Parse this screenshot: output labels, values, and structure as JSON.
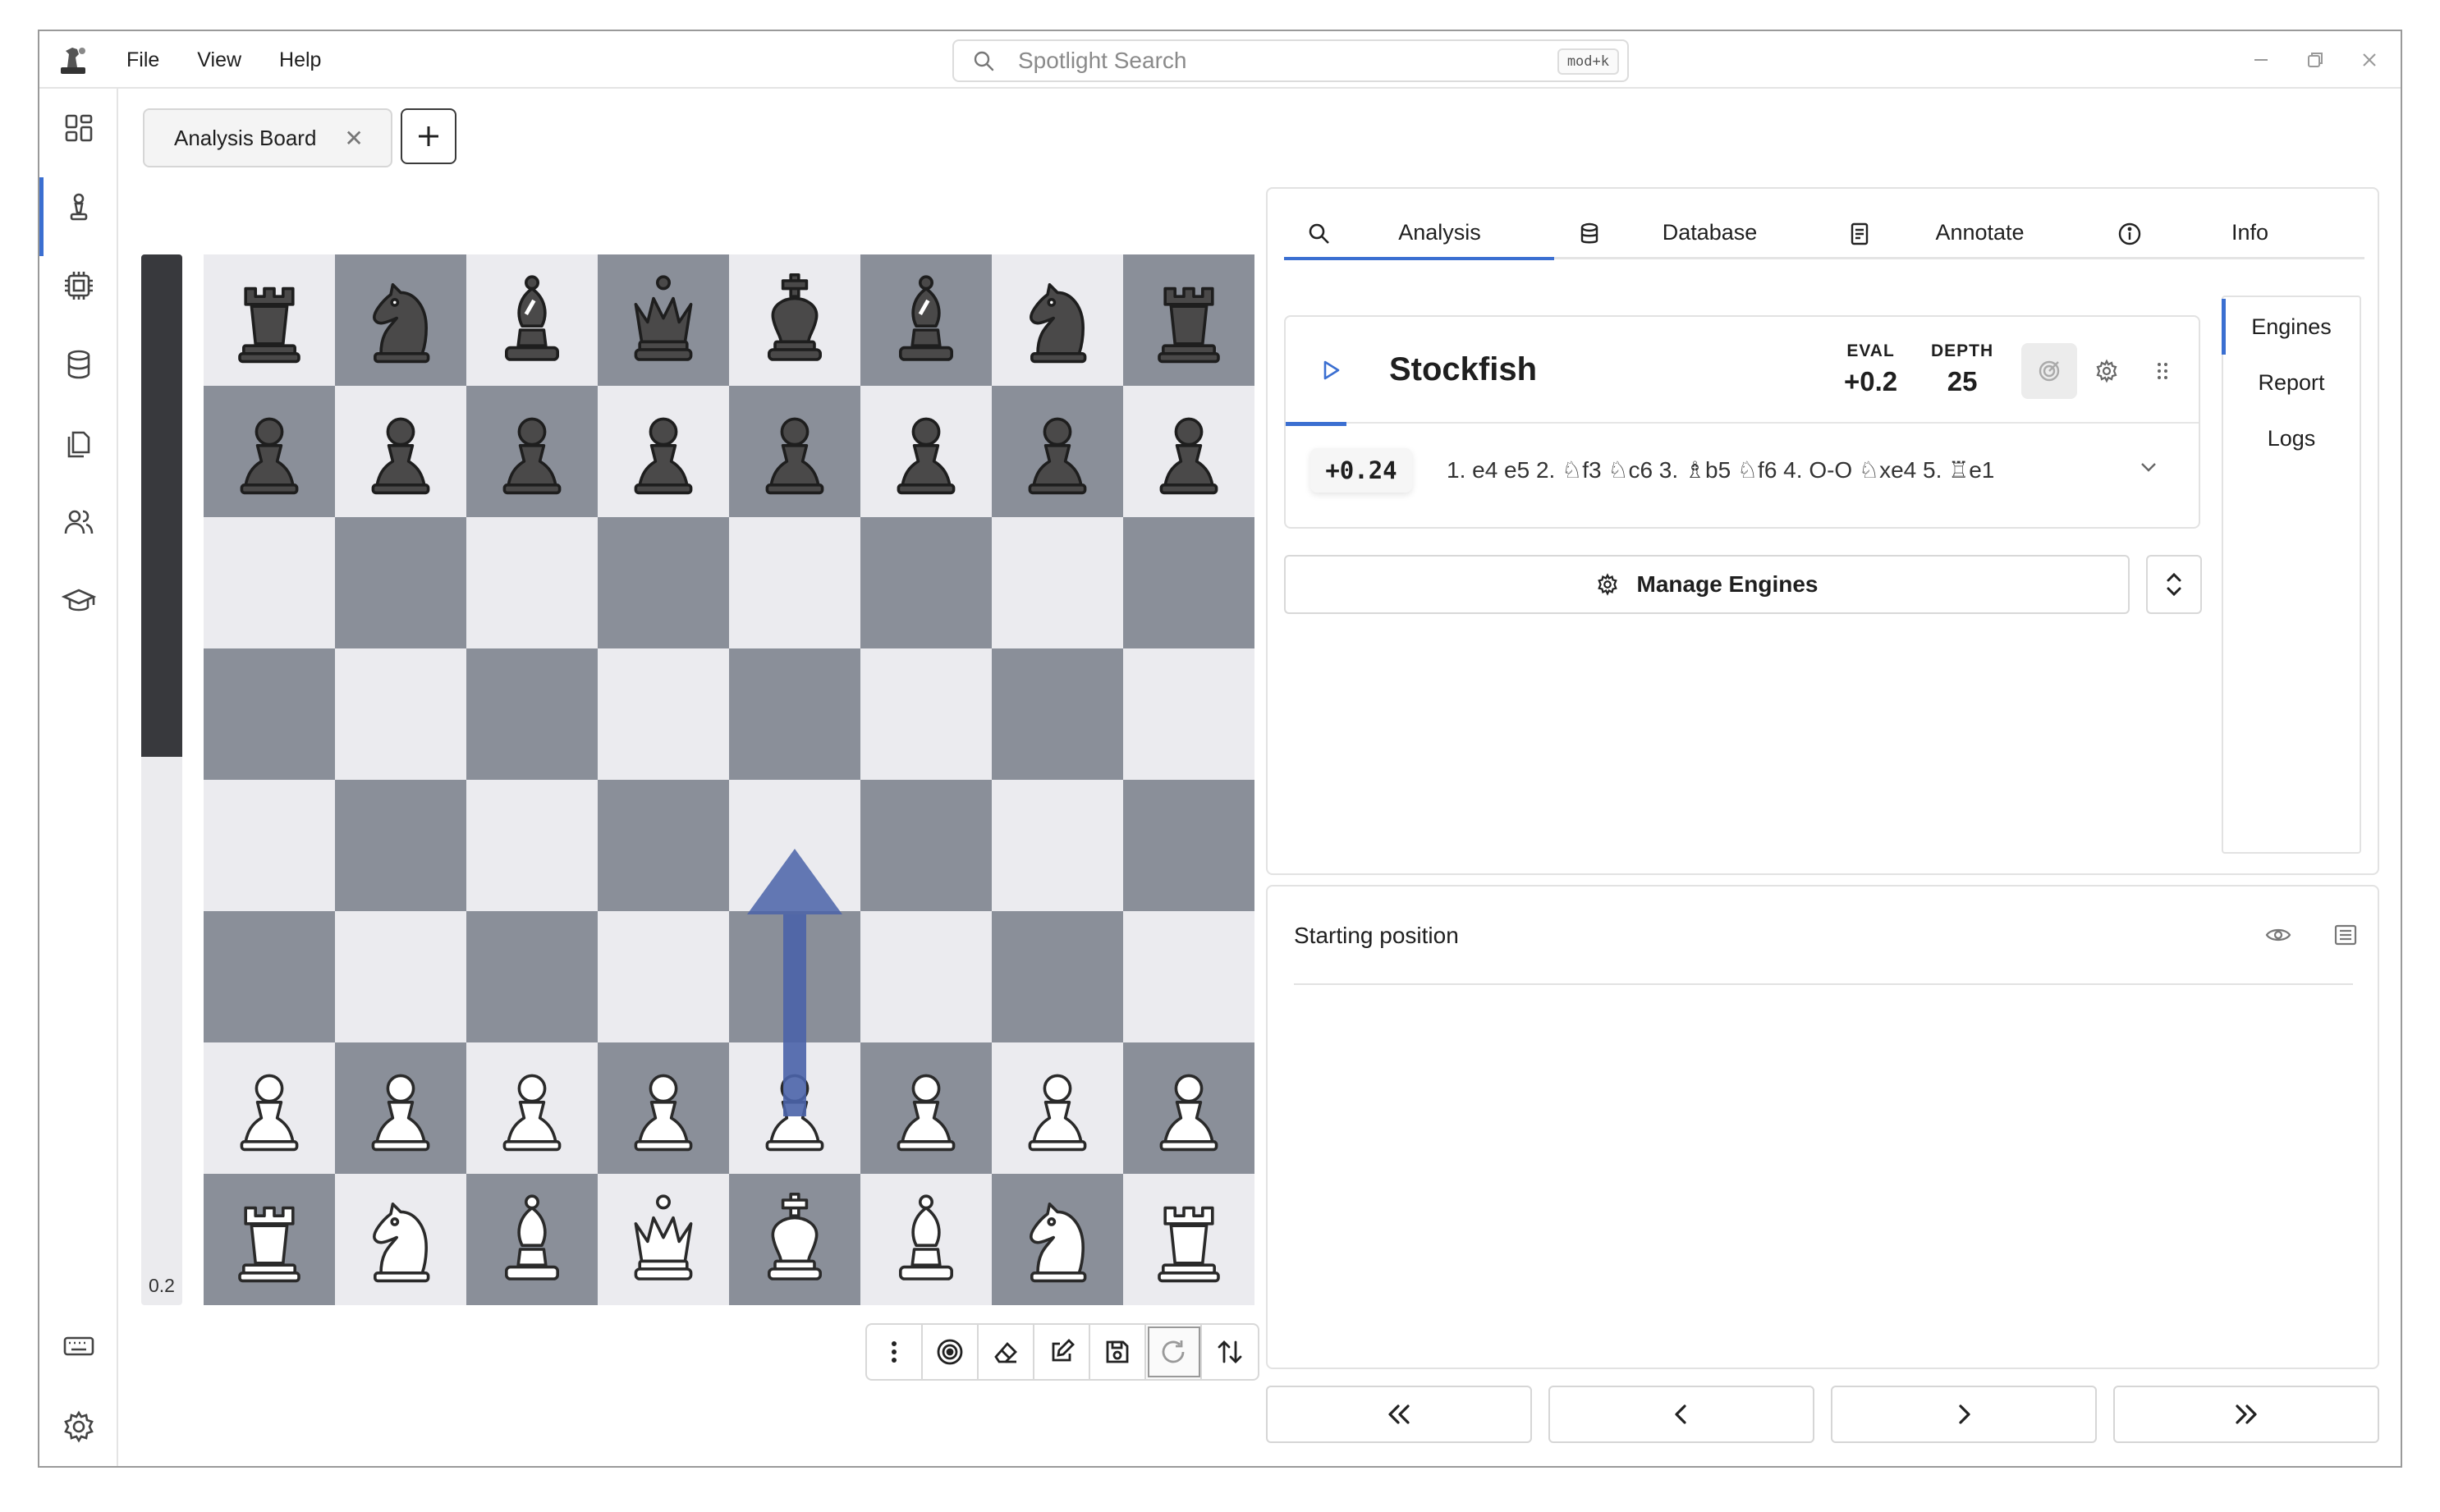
{
  "menu": [
    "File",
    "View",
    "Help"
  ],
  "spotlight": {
    "placeholder": "Spotlight Search",
    "shortcut": "mod+k"
  },
  "tabs": [
    {
      "label": "Analysis Board"
    }
  ],
  "eval_bar": {
    "value": "0.2",
    "black_fraction": 0.478
  },
  "board": {
    "ranks": [
      [
        "br",
        "bn",
        "bb",
        "bq",
        "bk",
        "bb",
        "bn",
        "br"
      ],
      [
        "bp",
        "bp",
        "bp",
        "bp",
        "bp",
        "bp",
        "bp",
        "bp"
      ],
      [
        "",
        "",
        "",
        "",
        "",
        "",
        "",
        ""
      ],
      [
        "",
        "",
        "",
        "",
        "",
        "",
        "",
        ""
      ],
      [
        "",
        "",
        "",
        "",
        "",
        "",
        "",
        ""
      ],
      [
        "",
        "",
        "",
        "",
        "",
        "",
        "",
        ""
      ],
      [
        "wp",
        "wp",
        "wp",
        "wp",
        "wp",
        "wp",
        "wp",
        "wp"
      ],
      [
        "wr",
        "wn",
        "wb",
        "wq",
        "wk",
        "wb",
        "wn",
        "wr"
      ]
    ],
    "arrow": {
      "from": "e2",
      "to": "e4",
      "color": "#4a63a8"
    }
  },
  "panel": {
    "tabs": [
      "Analysis",
      "Database",
      "Annotate",
      "Info"
    ],
    "active_tab": "Analysis",
    "side_tabs": [
      "Engines",
      "Report",
      "Logs"
    ],
    "active_side_tab": "Engines",
    "engine": {
      "name": "Stockfish",
      "eval_label": "EVAL",
      "eval": "+0.2",
      "depth_label": "DEPTH",
      "depth": "25",
      "score": "+0.24",
      "pv": "1. e4  e5 2. ♘f3  ♘c6 3. ♗b5  ♘f6 4. O-O  ♘xe4 5. ♖e1"
    },
    "manage_label": "Manage Engines"
  },
  "notes": {
    "title": "Starting position"
  },
  "colors": {
    "accent": "#3b6fd1",
    "light_square": "#ebebef",
    "dark_square": "#8a8f99"
  }
}
